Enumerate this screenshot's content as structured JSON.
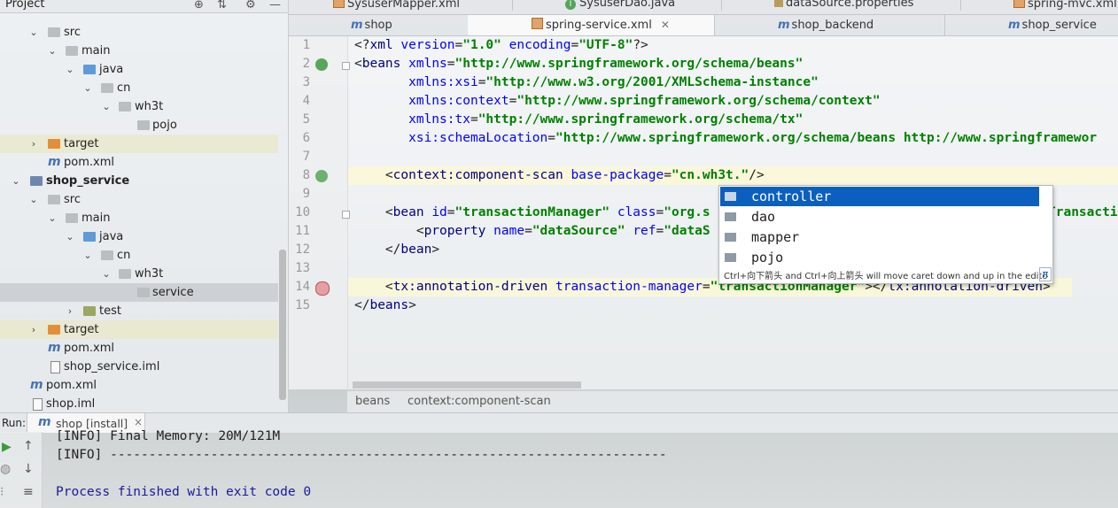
{
  "project_panel": {
    "title": "Project",
    "partial_top": "· · · · ·",
    "tree": [
      {
        "label": "src",
        "indent": 1
      },
      {
        "label": "main",
        "indent": 2
      },
      {
        "label": "java",
        "indent": 3
      },
      {
        "label": "cn",
        "indent": 4
      },
      {
        "label": "wh3t",
        "indent": 5
      },
      {
        "label": "pojo",
        "indent": 6
      },
      {
        "label": "target",
        "indent": 1
      },
      {
        "label": "pom.xml",
        "indent": 1
      },
      {
        "label": "shop_service",
        "indent": 0
      },
      {
        "label": "src",
        "indent": 1
      },
      {
        "label": "main",
        "indent": 2
      },
      {
        "label": "java",
        "indent": 3
      },
      {
        "label": "cn",
        "indent": 4
      },
      {
        "label": "wh3t",
        "indent": 5
      },
      {
        "label": "service",
        "indent": 6
      },
      {
        "label": "test",
        "indent": 3
      },
      {
        "label": "target",
        "indent": 1
      },
      {
        "label": "pom.xml",
        "indent": 1
      },
      {
        "label": "shop_service.iml",
        "indent": 1
      },
      {
        "label": "pom.xml",
        "indent": 0
      },
      {
        "label": "shop.iml",
        "indent": 0
      }
    ]
  },
  "tabs_row1": [
    {
      "label": "SysuserMapper.xml"
    },
    {
      "label": "SysuserDao.java"
    },
    {
      "label": "dataSource.properties"
    },
    {
      "label": "spring-mvc.xml"
    }
  ],
  "tabs_row2": [
    {
      "label": "shop"
    },
    {
      "label": "spring-service.xml",
      "active": true
    },
    {
      "label": "shop_backend"
    },
    {
      "label": "shop_service"
    }
  ],
  "editor": {
    "line_numbers": [
      "1",
      "2",
      "3",
      "4",
      "5",
      "6",
      "7",
      "8",
      "9",
      "10",
      "11",
      "12",
      "13",
      "14",
      "15"
    ],
    "lines": [
      {
        "parts": [
          [
            "p",
            "<?"
          ],
          [
            "t",
            "xml "
          ],
          [
            "a",
            "version"
          ],
          [
            "p",
            "="
          ],
          [
            "v",
            "\"1.0\" "
          ],
          [
            "a",
            "encoding"
          ],
          [
            "p",
            "="
          ],
          [
            "v",
            "\"UTF-8\""
          ],
          [
            "p",
            "?>"
          ]
        ]
      },
      {
        "parts": [
          [
            "p",
            "<"
          ],
          [
            "t",
            "beans "
          ],
          [
            "a",
            "xmlns"
          ],
          [
            "p",
            "="
          ],
          [
            "v",
            "\"http://www.springframework.org/schema/beans\""
          ]
        ]
      },
      {
        "parts": [
          [
            "p",
            "       "
          ],
          [
            "a",
            "xmlns:xsi"
          ],
          [
            "p",
            "="
          ],
          [
            "v",
            "\"http://www.w3.org/2001/XMLSchema-instance\""
          ]
        ]
      },
      {
        "parts": [
          [
            "p",
            "       "
          ],
          [
            "a",
            "xmlns:context"
          ],
          [
            "p",
            "="
          ],
          [
            "v",
            "\"http://www.springframework.org/schema/context\""
          ]
        ]
      },
      {
        "parts": [
          [
            "p",
            "       "
          ],
          [
            "a",
            "xmlns:tx"
          ],
          [
            "p",
            "="
          ],
          [
            "v",
            "\"http://www.springframework.org/schema/tx\""
          ]
        ]
      },
      {
        "parts": [
          [
            "p",
            "       "
          ],
          [
            "a",
            "xsi:schemaLocation"
          ],
          [
            "p",
            "="
          ],
          [
            "v",
            "\"http://www.springframework.org/schema/beans http://www.springframewor"
          ]
        ]
      },
      {
        "parts": [
          [
            "p",
            ""
          ]
        ]
      },
      {
        "parts": [
          [
            "p",
            "    <"
          ],
          [
            "t",
            "context:component-scan "
          ],
          [
            "a",
            "base-package"
          ],
          [
            "p",
            "="
          ],
          [
            "v",
            "\"cn.wh3t.\""
          ],
          [
            "p",
            "/>"
          ]
        ]
      },
      {
        "parts": [
          [
            "p",
            ""
          ]
        ]
      },
      {
        "parts": [
          [
            "p",
            "    <"
          ],
          [
            "t",
            "bean "
          ],
          [
            "a",
            "id"
          ],
          [
            "p",
            "="
          ],
          [
            "v",
            "\"transactionManager\" "
          ],
          [
            "a",
            "class"
          ],
          [
            "p",
            "="
          ],
          [
            "v",
            "\"org.s"
          ]
        ]
      },
      {
        "parts": [
          [
            "p",
            "        <"
          ],
          [
            "t",
            "property "
          ],
          [
            "a",
            "name"
          ],
          [
            "p",
            "="
          ],
          [
            "v",
            "\"dataSource\" "
          ],
          [
            "a",
            "ref"
          ],
          [
            "p",
            "="
          ],
          [
            "v",
            "\"dataS"
          ]
        ]
      },
      {
        "parts": [
          [
            "p",
            "    </"
          ],
          [
            "t",
            "bean"
          ],
          [
            "p",
            ">"
          ]
        ]
      },
      {
        "parts": [
          [
            "p",
            ""
          ]
        ]
      },
      {
        "parts": [
          [
            "p",
            "    <"
          ],
          [
            "t",
            "tx:annotation-driven "
          ],
          [
            "a",
            "transaction-manager"
          ],
          [
            "p",
            "="
          ],
          [
            "v",
            "\"transactionManager\""
          ],
          [
            "p",
            "></"
          ],
          [
            "t",
            "tx:annotation-driven"
          ],
          [
            "p",
            ">"
          ]
        ]
      },
      {
        "parts": [
          [
            "p",
            "</"
          ],
          [
            "t",
            "beans"
          ],
          [
            "p",
            ">"
          ]
        ]
      }
    ],
    "overflow_right_line10": "Transacti"
  },
  "completion": {
    "items": [
      "controller",
      "dao",
      "mapper",
      "pojo"
    ],
    "selected_index": 0,
    "hint": "Ctrl+向下箭头 and Ctrl+向上箭头 will move caret down and up in the edito",
    "pi": "π"
  },
  "breadcrumb": [
    "beans",
    "context:component-scan"
  ],
  "run": {
    "label": "Run:",
    "tab": "shop [install]",
    "close": "×",
    "console": [
      "[INFO] Final Memory: 20M/121M",
      "[INFO] ------------------------------------------------------------------------",
      "",
      "Process finished with exit code 0"
    ]
  }
}
